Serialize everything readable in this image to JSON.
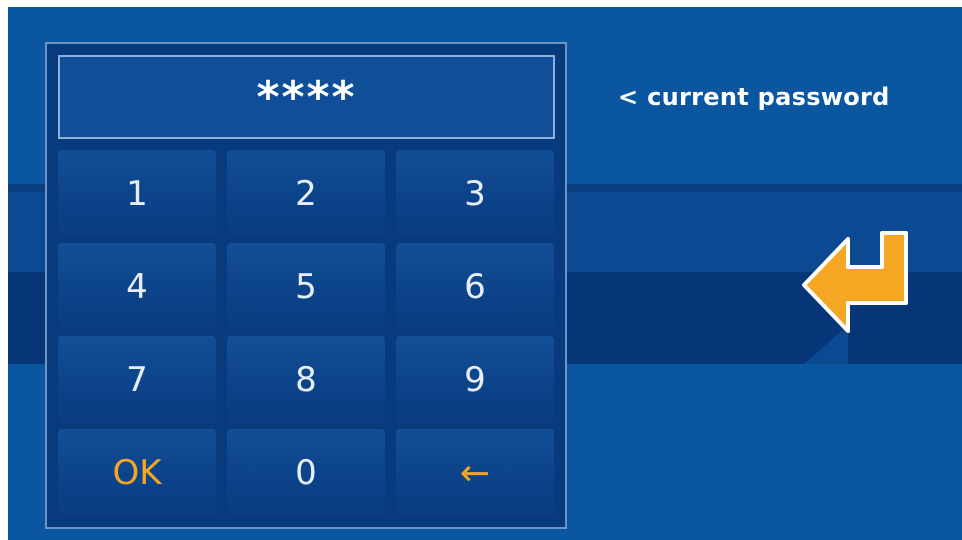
{
  "password_field": {
    "masked_value": "****"
  },
  "prompt": {
    "label": "< current password"
  },
  "keypad": {
    "keys": [
      {
        "label": "1",
        "name": "key-1"
      },
      {
        "label": "2",
        "name": "key-2"
      },
      {
        "label": "3",
        "name": "key-3"
      },
      {
        "label": "4",
        "name": "key-4"
      },
      {
        "label": "5",
        "name": "key-5"
      },
      {
        "label": "6",
        "name": "key-6"
      },
      {
        "label": "7",
        "name": "key-7"
      },
      {
        "label": "8",
        "name": "key-8"
      },
      {
        "label": "9",
        "name": "key-9"
      },
      {
        "label": "OK",
        "name": "ok-button"
      },
      {
        "label": "0",
        "name": "key-0"
      },
      {
        "label": "←",
        "name": "backspace-button"
      }
    ]
  },
  "icons": {
    "enter": "enter-arrow-icon",
    "backspace": "left-arrow-icon"
  },
  "colors": {
    "background": "#0a56a0",
    "accent": "#f5a623",
    "text": "#ffffff"
  }
}
